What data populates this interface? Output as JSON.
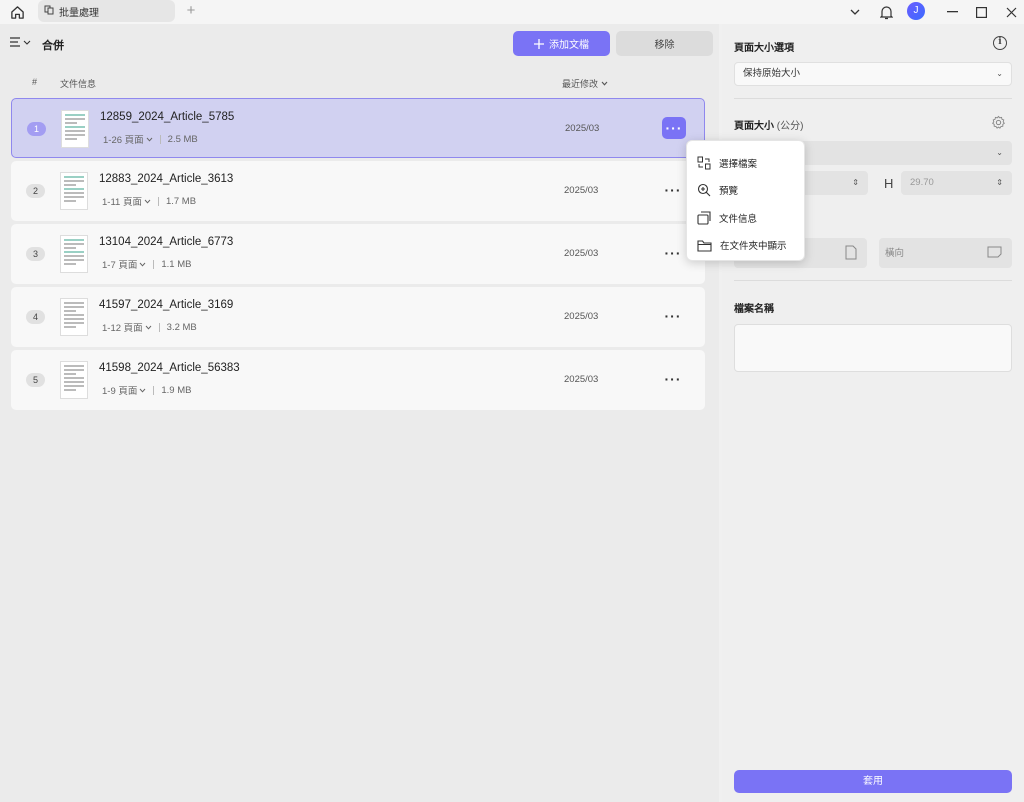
{
  "titlebar": {
    "tab_label": "批量處理",
    "avatar_initial": "J"
  },
  "toolbar": {
    "page_title": "合併",
    "add_label": "添加文檔",
    "remove_label": "移除"
  },
  "table": {
    "col_index": "#",
    "col_info": "文件信息",
    "col_modified": "最近修改"
  },
  "rows": [
    {
      "num": "1",
      "name": "12859_2024_Article_5785",
      "pages": "1-26 頁面",
      "size": "2.5 MB",
      "date": "2025/03"
    },
    {
      "num": "2",
      "name": "12883_2024_Article_3613",
      "pages": "1-11 頁面",
      "size": "1.7 MB",
      "date": "2025/03"
    },
    {
      "num": "3",
      "name": "13104_2024_Article_6773",
      "pages": "1-7 頁面",
      "size": "1.1 MB",
      "date": "2025/03"
    },
    {
      "num": "4",
      "name": "41597_2024_Article_3169",
      "pages": "1-12 頁面",
      "size": "3.2 MB",
      "date": "2025/03"
    },
    {
      "num": "5",
      "name": "41598_2024_Article_56383",
      "pages": "1-9 頁面",
      "size": "1.9 MB",
      "date": "2025/03"
    }
  ],
  "context_menu": {
    "items": [
      "選擇檔案",
      "預覽",
      "文件信息",
      "在文件夾中顯示"
    ]
  },
  "panel": {
    "page_size_options_title": "頁面大小選項",
    "page_size_option_value": "保持原始大小",
    "page_size_title": "頁面大小",
    "page_size_unit": "(公分)",
    "height_label": "H",
    "height_value": "29.70",
    "landscape_label": "橫向",
    "file_name_title": "檔案名稱",
    "apply_label": "套用"
  }
}
